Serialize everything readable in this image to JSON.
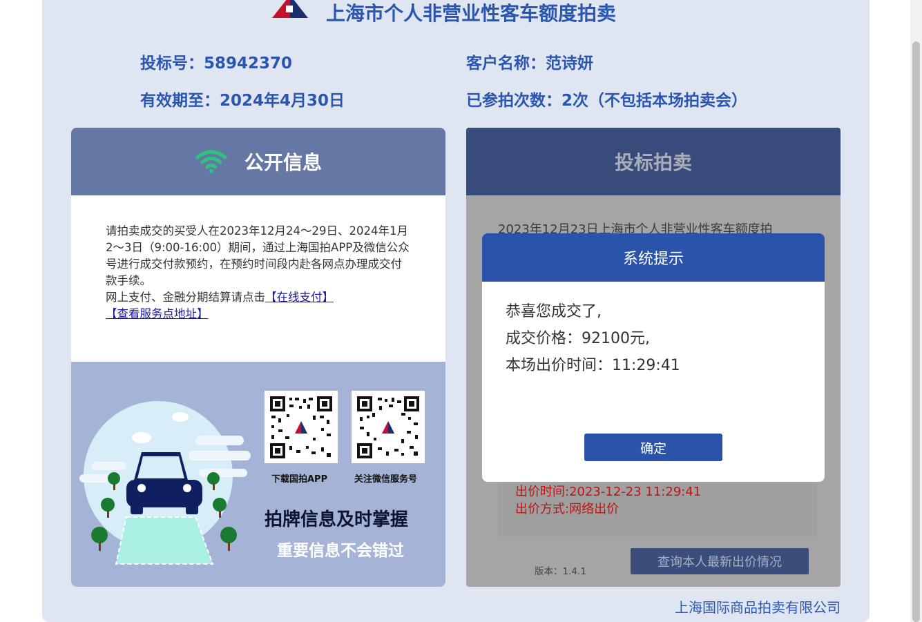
{
  "header": {
    "title": "上海市个人非营业性客车额度拍卖"
  },
  "bidder": {
    "bid_no": "投标号：58942370",
    "customer": "客户名称：范诗妍",
    "valid_until": "有效期至：2024年4月30日",
    "times": "已参拍次数：2次（不包括本场拍卖会）"
  },
  "public_info": {
    "title": "公开信息",
    "notice": "请拍卖成交的买受人在2023年12月24～29日、2024年1月2～3日（9:00-16:00）期间，通过上海国拍APP及微信公众号进行成交付款预约，在预约时间段内赴各网点办理成交付款手续。",
    "pay_prefix": "网上支付、金融分期结算请点击",
    "pay_link": "【在线支付】",
    "service_link": "【查看服务点地址】",
    "qr_app_label": "下载国拍APP",
    "qr_wechat_label": "关注微信服务号",
    "slogan_main": "拍牌信息及时掌握",
    "slogan_sub": "重要信息不会错过"
  },
  "bidding": {
    "title": "投标拍卖",
    "auction_text": "2023年12月23日上海市个人非营业性客车额度拍",
    "bid_time": "出价时间:2023-12-23 11:29:41",
    "bid_method": "出价方式:网络出价",
    "version": "版本：1.4.1",
    "query_button": "查询本人最新出价情况"
  },
  "modal": {
    "title": "系统提示",
    "line1": "恭喜您成交了,",
    "line2": "成交价格：92100元,",
    "line3": "本场出价时间：11:29:41",
    "ok": "确定"
  },
  "footer": {
    "company": "上海国际商品拍卖有限公司"
  },
  "colors": {
    "brand_blue": "#2a56b0",
    "page_bg": "#dfe5f1",
    "card_head_public": "#6577a4",
    "card_head_bid": "#384c7c",
    "modal_blue": "#2a54aa",
    "wifi_green": "#2ec27e",
    "alert_red": "#c01313"
  },
  "icons": {
    "logo": "auction-logo-icon",
    "signal": "wifi-signal-icon",
    "qr_app": "qr-code-icon",
    "qr_wechat": "qr-code-icon",
    "illustration": "car-road-illustration"
  }
}
